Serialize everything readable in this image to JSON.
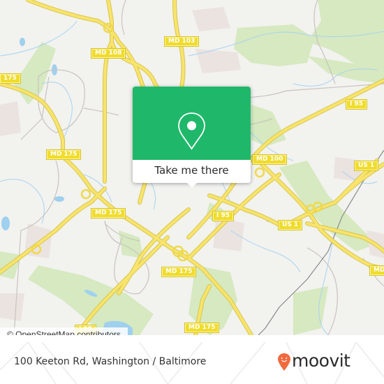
{
  "map": {
    "route_shields": [
      {
        "label": "MD 103"
      },
      {
        "label": "MD 108"
      },
      {
        "label": "175"
      },
      {
        "label": "MD 175"
      },
      {
        "label": "MD 175"
      },
      {
        "label": "MD 175"
      },
      {
        "label": "MD 175"
      },
      {
        "label": "I 95"
      },
      {
        "label": "I 95"
      },
      {
        "label": "MD 100"
      },
      {
        "label": "US 1"
      },
      {
        "label": "US 1"
      },
      {
        "label": "MD"
      },
      {
        "label": "I 95"
      }
    ],
    "attribution": "© OpenStreetMap contributors",
    "colors": {
      "land": "#f2f2ef",
      "park": "#d3e8bc",
      "water": "#9dcfee",
      "road": "#f6e05e",
      "residential": "#ece4e1"
    }
  },
  "popup": {
    "icon": "map-pin-icon",
    "cta_label": "Take me there",
    "accent_color": "#1fb86a"
  },
  "footer": {
    "address": "100 Keeton Rd, Washington / Baltimore",
    "brand": "moovit",
    "brand_icon": "moovit-pin-logo-icon",
    "brand_color": "#f26a3d"
  }
}
